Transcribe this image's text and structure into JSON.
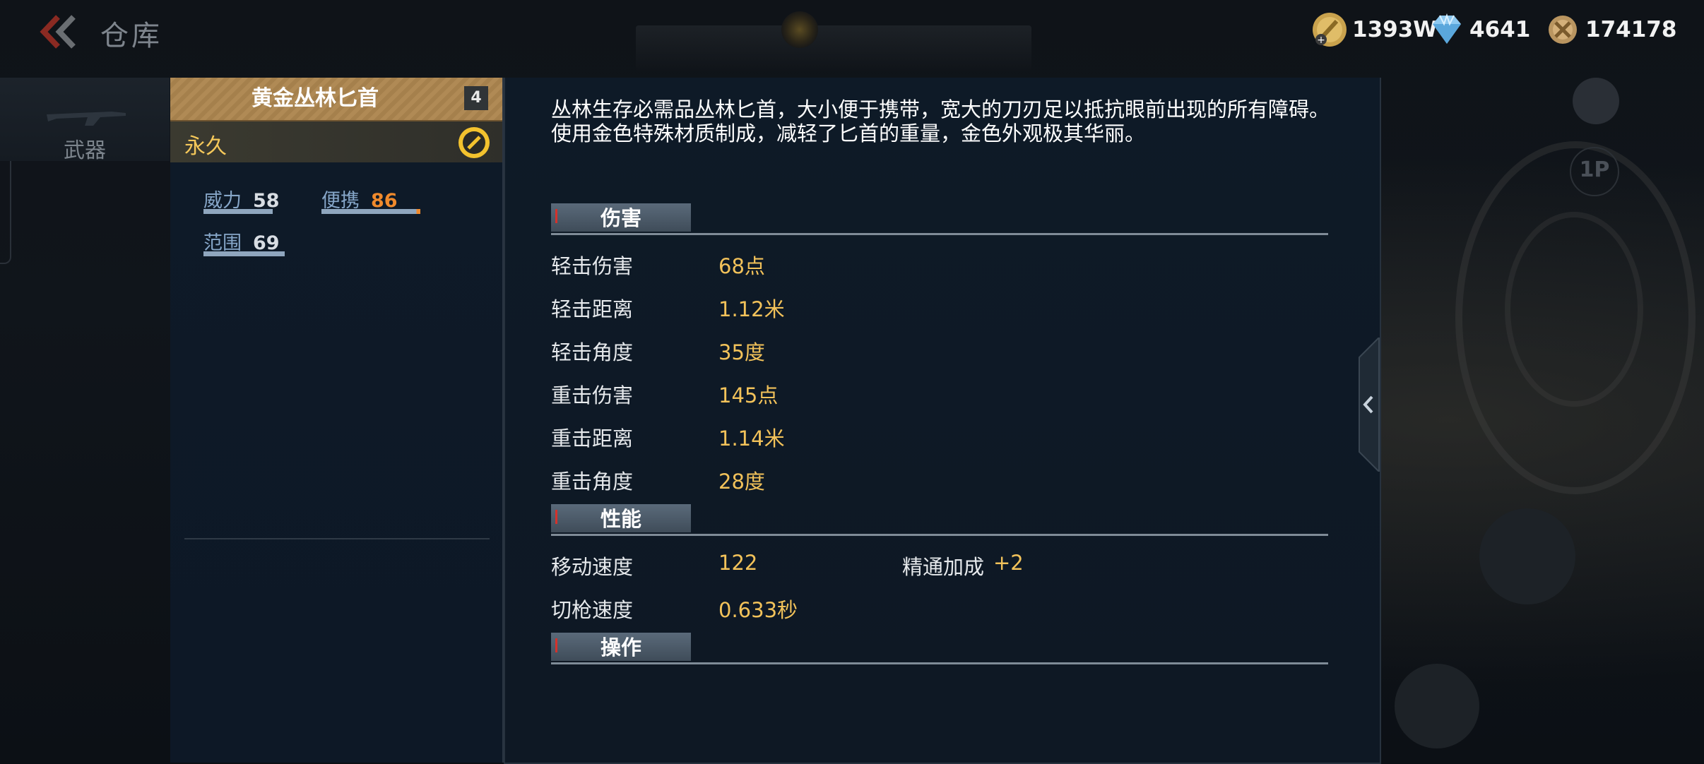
{
  "header": {
    "title": "仓库",
    "currencies": [
      {
        "icon": "gold-coin-icon",
        "value": "1393W"
      },
      {
        "icon": "diamond-icon",
        "value": "4641"
      },
      {
        "icon": "honor-medal-icon",
        "value": "174178"
      }
    ]
  },
  "sidebar": {
    "tabs": [
      {
        "label": "武器",
        "icon": "rifle-icon",
        "selected": true
      }
    ]
  },
  "item": {
    "name": "黄金丛林匕首",
    "level": "4",
    "duration": "永久",
    "stats": [
      {
        "label": "威力",
        "value": "58",
        "fill": 0.58,
        "color": "#d8dde3"
      },
      {
        "label": "便携",
        "value": "86",
        "fill": 0.86,
        "color": "#f08a2c"
      },
      {
        "label": "范围",
        "value": "69",
        "fill": 0.69,
        "color": "#d8dde3"
      }
    ]
  },
  "detail": {
    "description": "丛林生存必需品丛林匕首，大小便于携带，宽大的刀刃足以抵抗眼前出现的所有障碍。使用金色特殊材质制成，减轻了匕首的重量，金色外观极其华丽。",
    "sections": {
      "damage": {
        "title": "伤害",
        "rows": [
          {
            "label": "轻击伤害",
            "value": "68点"
          },
          {
            "label": "轻击距离",
            "value": "1.12米"
          },
          {
            "label": "轻击角度",
            "value": "35度"
          },
          {
            "label": "重击伤害",
            "value": "145点"
          },
          {
            "label": "重击距离",
            "value": "1.14米"
          },
          {
            "label": "重击角度",
            "value": "28度"
          }
        ]
      },
      "performance": {
        "title": "性能",
        "rows": [
          {
            "label": "移动速度",
            "value": "122",
            "extra_label": "精通加成",
            "extra_value": "+2"
          },
          {
            "label": "切枪速度",
            "value": "0.633秒"
          }
        ]
      },
      "operation": {
        "title": "操作"
      }
    }
  },
  "hud": {
    "view_toggle": "1P"
  },
  "colors": {
    "accent_gold": "#f2c25a",
    "header_gold": "#b08a55",
    "panel_bg": "#0e1a28",
    "section_head": "#4d5b69"
  }
}
